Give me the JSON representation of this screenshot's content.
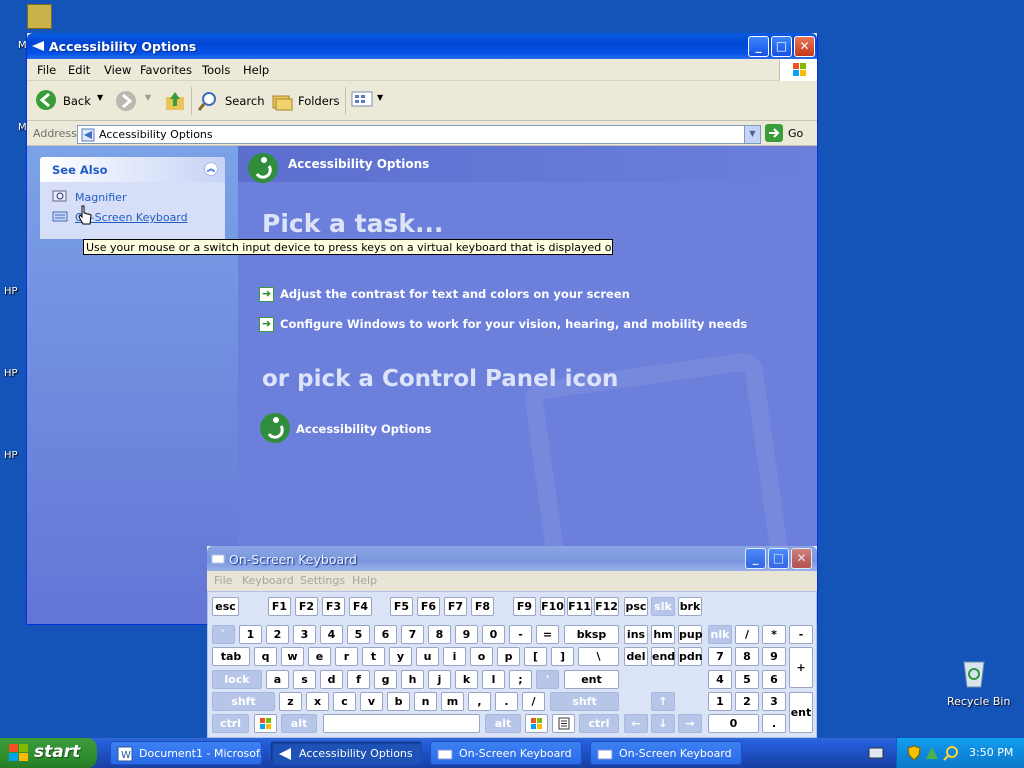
{
  "desktop": {
    "side_labels": [
      "M",
      "M",
      "HP",
      "HP",
      "HP"
    ],
    "recycle_bin_label": "Recycle Bin"
  },
  "main_window": {
    "title": "Accessibility Options",
    "menu": [
      "File",
      "Edit",
      "View",
      "Favorites",
      "Tools",
      "Help"
    ],
    "toolbar": {
      "back": "Back",
      "search": "Search",
      "folders": "Folders"
    },
    "address": {
      "label": "Address",
      "value": "Accessibility Options",
      "go": "Go"
    },
    "see_also": {
      "header": "See Also",
      "items": [
        "Magnifier",
        "On-Screen Keyboard"
      ]
    },
    "content": {
      "header": "Accessibility Options",
      "pick_task": "Pick a task...",
      "tasks": [
        "Adjust the contrast for text and colors on your screen",
        "Configure Windows to work for your vision, hearing, and mobility needs"
      ],
      "pick_icon": "or pick a Control Panel icon",
      "icon_label": "Accessibility Options"
    }
  },
  "tooltip": "Use your mouse or a switch input device to press keys on a virtual keyboard that is displayed on your screen.",
  "osk_window": {
    "title": "On-Screen Keyboard",
    "menu": [
      "File",
      "Keyboard",
      "Settings",
      "Help"
    ],
    "keys": {
      "row1": [
        "esc",
        "F1",
        "F2",
        "F3",
        "F4",
        "F5",
        "F6",
        "F7",
        "F8",
        "F9",
        "F10",
        "F11",
        "F12",
        "psc",
        "slk",
        "brk"
      ],
      "row2": [
        "`",
        "1",
        "2",
        "3",
        "4",
        "5",
        "6",
        "7",
        "8",
        "9",
        "0",
        "-",
        "=",
        "bksp",
        "ins",
        "hm",
        "pup",
        "nlk",
        "/",
        "*",
        "-"
      ],
      "row3": [
        "tab",
        "q",
        "w",
        "e",
        "r",
        "t",
        "y",
        "u",
        "i",
        "o",
        "p",
        "[",
        "]",
        "\\",
        "del",
        "end",
        "pdn",
        "7",
        "8",
        "9",
        "+"
      ],
      "row4": [
        "lock",
        "a",
        "s",
        "d",
        "f",
        "g",
        "h",
        "j",
        "k",
        "l",
        ";",
        "'",
        "ent",
        "4",
        "5",
        "6"
      ],
      "row5": [
        "shft",
        "z",
        "x",
        "c",
        "v",
        "b",
        "n",
        "m",
        ",",
        ".",
        "/",
        "shft",
        "↑",
        "1",
        "2",
        "3",
        "ent"
      ],
      "row6": [
        "ctrl",
        "alt",
        "alt",
        "ctrl",
        "←",
        "↓",
        "→",
        "0",
        "."
      ]
    }
  },
  "taskbar": {
    "start": "start",
    "buttons": [
      "Document1 - Microsof...",
      "Accessibility Options",
      "On-Screen Keyboard",
      "On-Screen Keyboard"
    ],
    "clock": "3:50 PM"
  }
}
